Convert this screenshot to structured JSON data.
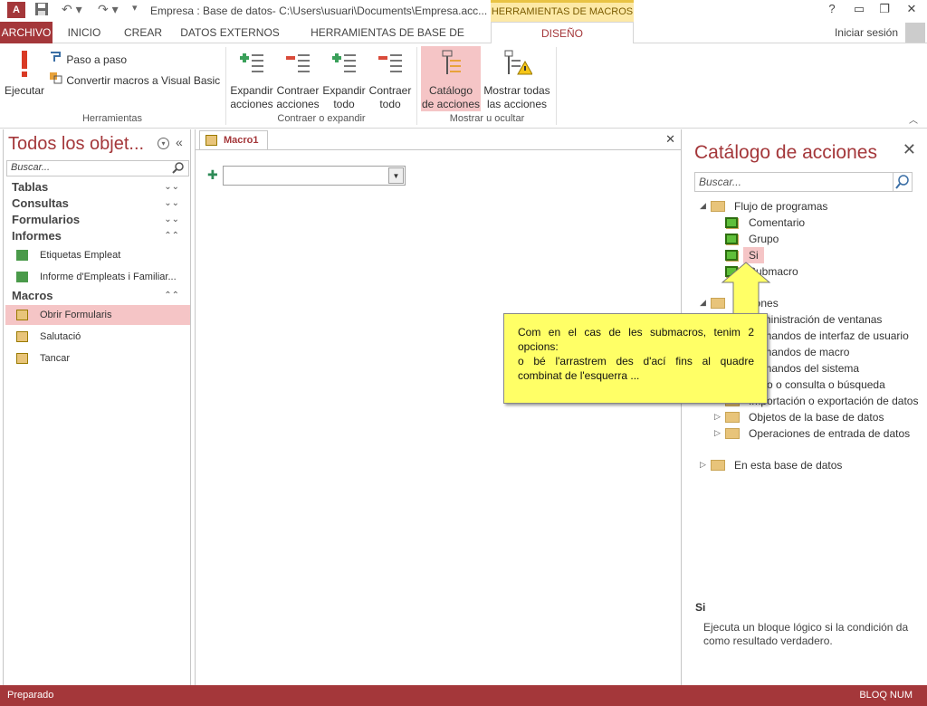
{
  "window": {
    "title": "Empresa : Base de datos- C:\\Users\\usuari\\Documents\\Empresa.acc...",
    "context_tab_header": "HERRAMIENTAS DE MACROS",
    "help": "?",
    "minimize": "▭",
    "restore": "❐",
    "close": "✕"
  },
  "tabs": {
    "file": "ARCHIVO",
    "home": "INICIO",
    "create": "CREAR",
    "external": "DATOS EXTERNOS",
    "dbtools": "HERRAMIENTAS DE BASE DE DATOS",
    "design": "DISEÑO",
    "signin": "Iniciar sesión"
  },
  "ribbon": {
    "run": "Ejecutar",
    "step": "Paso a paso",
    "convert": "Convertir macros a Visual Basic",
    "tools_group": "Herramientas",
    "expand_actions": [
      "Expandir",
      "acciones"
    ],
    "collapse_actions": [
      "Contraer",
      "acciones"
    ],
    "expand_all": [
      "Expandir",
      "todo"
    ],
    "collapse_all": [
      "Contraer",
      "todo"
    ],
    "expand_group": "Contraer o expandir",
    "action_catalog": [
      "Catálogo",
      "de acciones"
    ],
    "show_all": [
      "Mostrar todas",
      "las acciones"
    ],
    "show_group": "Mostrar u ocultar"
  },
  "nav": {
    "title": "Todos los objet...",
    "search_placeholder": "Buscar...",
    "groups": {
      "tables": "Tablas",
      "queries": "Consultas",
      "forms": "Formularios",
      "reports": "Informes",
      "macros": "Macros"
    },
    "reports": [
      "Etiquetas Empleat",
      "Informe d'Empleats i Familiar..."
    ],
    "macros": [
      "Obrir Formularis",
      "Salutació",
      "Tancar"
    ]
  },
  "document": {
    "tab": "Macro1",
    "close": "✕",
    "combo_value": ""
  },
  "catalog": {
    "title": "Catálogo de acciones",
    "search_placeholder": "Buscar...",
    "flow": "Flujo de programas",
    "flow_items": [
      "Comentario",
      "Grupo",
      "Si",
      "Submacro"
    ],
    "actions": "Acciones",
    "action_items": [
      "Administración de ventanas",
      "Comandos de interfaz de usuario",
      "Comandos de macro",
      "Comandos del sistema",
      "Filtro o consulta o búsqueda",
      "Importación o exportación de datos",
      "Objetos de la base de datos",
      "Operaciones de entrada de datos"
    ],
    "in_db": "En esta base de datos",
    "info_title": "Si",
    "info_desc": "Ejecuta un bloque lógico si la condición da como resultado verdadero."
  },
  "callout": {
    "line1": "Com en el cas de les submacros, tenim 2 opcions:",
    "line2": "o bé l'arrastrem des d'ací fins al quadre combinat de l'esquerra ..."
  },
  "status": {
    "left": "Preparado",
    "right": "BLOQ NUM"
  },
  "colors": {
    "accent": "#a4373a",
    "selection": "#f5c5c6",
    "callout": "#ffff66"
  }
}
